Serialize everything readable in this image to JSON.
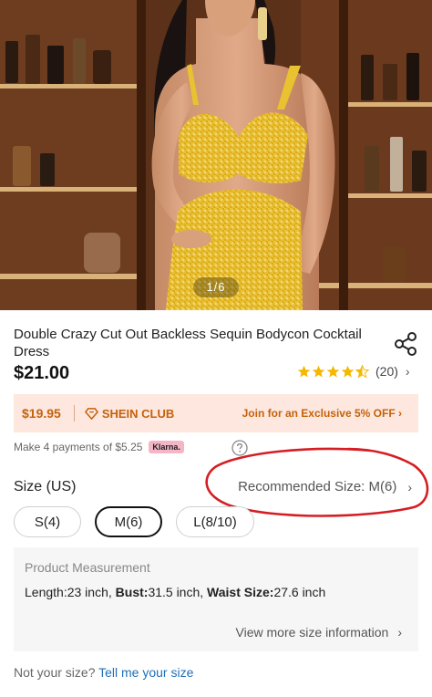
{
  "gallery": {
    "counter": "1/6"
  },
  "product": {
    "title": "Double Crazy Cut Out Backless Sequin Bodycon Cocktail Dress",
    "price": "$21.00",
    "rating": {
      "stars": 4.5,
      "count": "(20)"
    }
  },
  "club": {
    "price": "$19.95",
    "name": "SHEIN CLUB",
    "join_text": "Join for an Exclusive 5% OFF",
    "accent": "#c5620a",
    "background": "#fde7df"
  },
  "installments": {
    "text": "Make 4 payments of $5.25",
    "provider": "Klarna."
  },
  "size": {
    "label": "Size (US)",
    "recommended": "Recommended Size: M(6)",
    "options": [
      {
        "label": "S(4)",
        "selected": false
      },
      {
        "label": "M(6)",
        "selected": true
      },
      {
        "label": "L(8/10)",
        "selected": false
      }
    ]
  },
  "measurement": {
    "title": "Product Measurement",
    "length_label": "Length:",
    "length_value": "23 inch,",
    "bust_label": "Bust:",
    "bust_value": "31.5 inch,",
    "waist_label": "Waist Size:",
    "waist_value": "27.6 inch",
    "more_link": "View more size information"
  },
  "fit": {
    "question": "Not your size?",
    "link": "Tell me your size"
  },
  "icons": [
    "share-icon",
    "star-icon",
    "chevron-right-icon",
    "shein-club-logo-icon",
    "help-icon"
  ],
  "colors": {
    "annotation": "#d41e24",
    "link": "#1f6fb8",
    "dress": "#e2b61c"
  }
}
